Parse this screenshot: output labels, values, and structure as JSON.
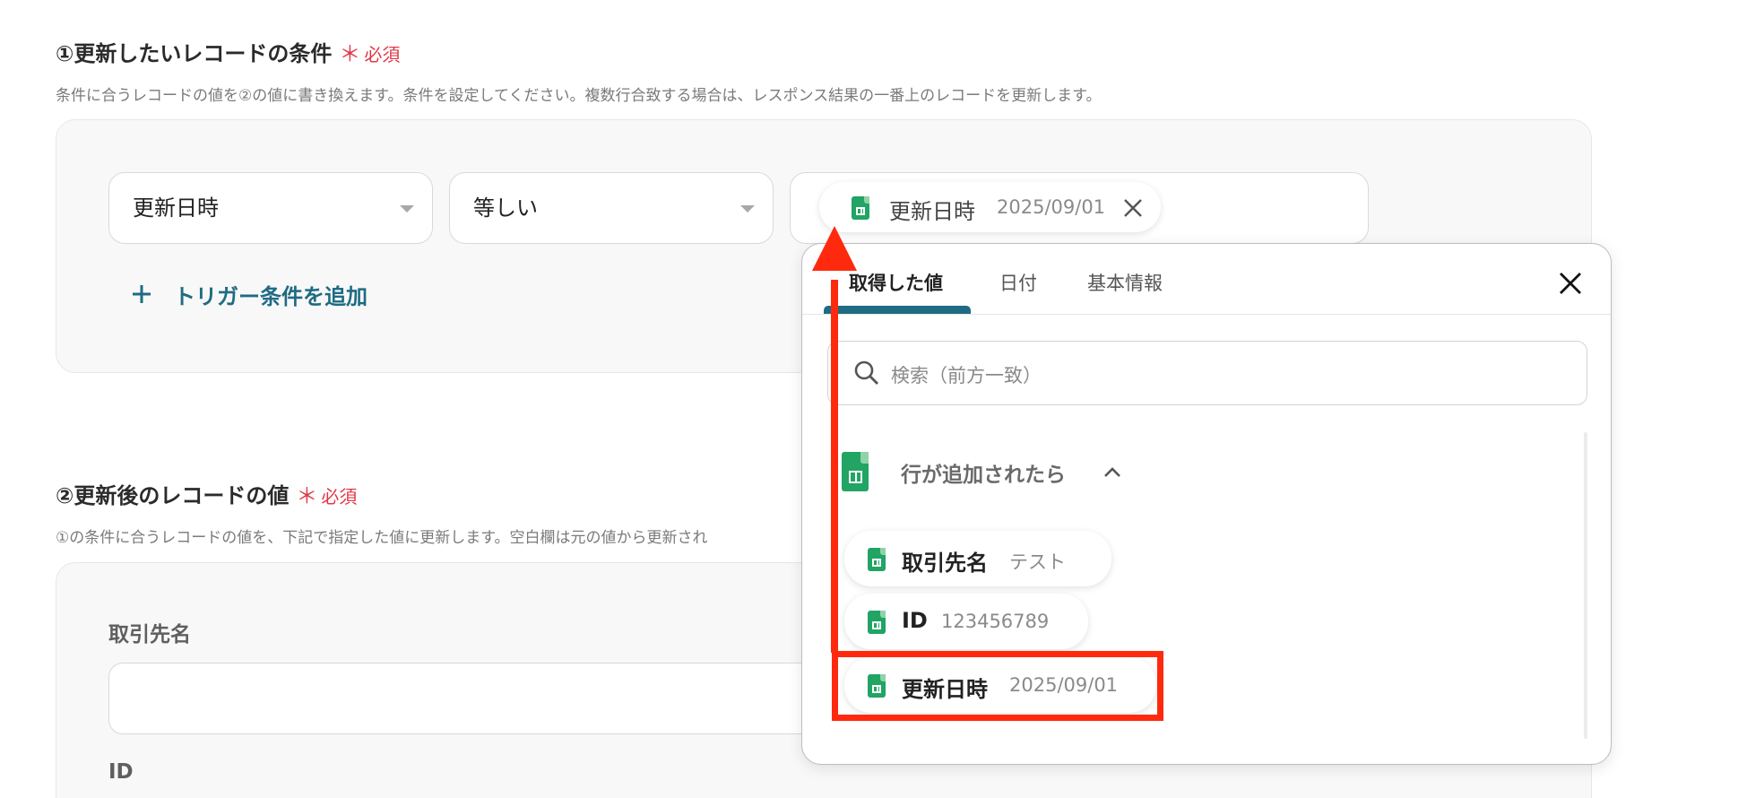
{
  "section1": {
    "number": "①",
    "title": "更新したいレコードの条件",
    "required_mark": "＊",
    "required_text": "必須",
    "description": "条件に合うレコードの値を②の値に書き換えます。条件を設定してください。複数行合致する場合は、レスポンス結果の一番上のレコードを更新します。"
  },
  "condition": {
    "field_value": "更新日時",
    "operator_value": "等しい",
    "value_chip": {
      "name": "更新日時",
      "sample": "2025/09/01"
    },
    "add_label": "トリガー条件を追加"
  },
  "section2": {
    "number": "②",
    "title": "更新後のレコードの値",
    "required_mark": "＊",
    "required_text": "必須",
    "description": "①の条件に合うレコードの値を、下記で指定した値に更新します。空白欄は元の値から更新され"
  },
  "fields": [
    {
      "label": "取引先名",
      "value": ""
    },
    {
      "label": "ID"
    }
  ],
  "popup": {
    "tabs": [
      {
        "label": "取得した値",
        "active": true
      },
      {
        "label": "日付",
        "active": false
      },
      {
        "label": "基本情報",
        "active": false
      }
    ],
    "search_placeholder": "検索（前方一致）",
    "group": {
      "title": "行が追加されたら",
      "items": [
        {
          "name": "取引先名",
          "sample": "テスト"
        },
        {
          "name": "ID",
          "sample": "123456789"
        },
        {
          "name": "更新日時",
          "sample": "2025/09/01",
          "highlighted": true
        }
      ]
    }
  },
  "colors": {
    "accent_teal": "#1f6b83",
    "required_red": "#e0394a",
    "highlight_red": "#ff2a0e",
    "sheet_green": "#21a464"
  },
  "icons": [
    "google-sheets-icon",
    "close-icon",
    "search-icon",
    "chevron-up-icon",
    "plus-icon",
    "chevron-down-icon"
  ]
}
